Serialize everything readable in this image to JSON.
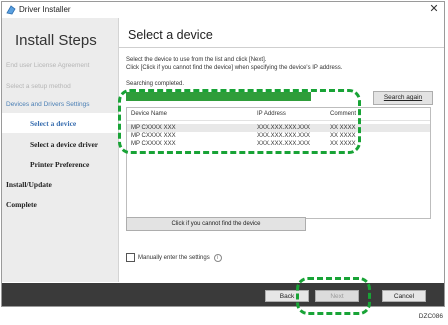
{
  "window": {
    "title": "Driver Installer",
    "close": "✕"
  },
  "sidebar": {
    "title": "Install Steps",
    "items": [
      {
        "label": "End user License Agreement"
      },
      {
        "label": "Select a setup method"
      },
      {
        "label": "Devices and Drivers Settings"
      }
    ],
    "subitems": [
      {
        "label": "Select a device"
      },
      {
        "label": "Select a device driver"
      },
      {
        "label": "Printer Preference"
      },
      {
        "label": "Install/Update"
      },
      {
        "label": "Complete"
      }
    ]
  },
  "main": {
    "title": "Select a device",
    "instruction_line1": "Select the device to use from the list and click [Next].",
    "instruction_line2": "Click [Click if you cannot find the device] when specifying the device's IP address.",
    "status": "Searching completed.",
    "search_again": "Search again",
    "columns": {
      "name": "Device Name",
      "ip": "IP Address",
      "comment": "Comment"
    },
    "devices": [
      {
        "name": "MP CXXXX XXX",
        "ip": "XXX.XXX.XXX.XXX",
        "comment": "XX XXXX"
      },
      {
        "name": "MP CXXXX XXX",
        "ip": "XXX.XXX.XXX.XXX",
        "comment": "XX XXXX"
      },
      {
        "name": "MP CXXXX XXX",
        "ip": "XXX.XXX.XXX.XXX",
        "comment": "XX XXXX"
      }
    ],
    "notfound_button": "Click if you cannot find the device",
    "manual_label": "Manually enter the settings",
    "info": "i"
  },
  "footer": {
    "back": "Back",
    "next": "Next",
    "cancel": "Cancel"
  },
  "caption": "DZC086",
  "colors": {
    "accent": "#18a336",
    "progress": "#2f9d3a",
    "footer": "#3a3a3a"
  }
}
